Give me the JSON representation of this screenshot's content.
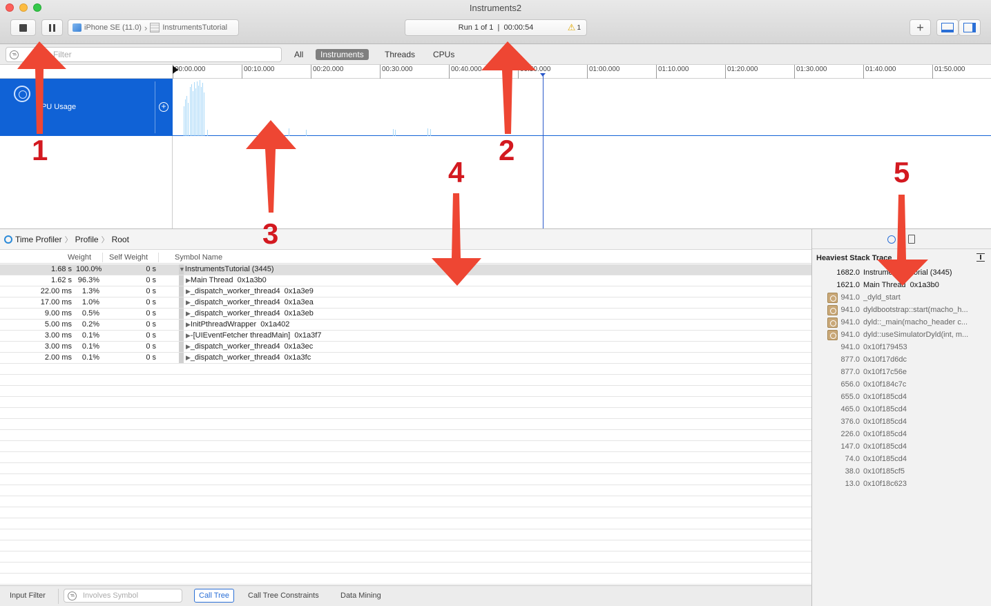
{
  "window": {
    "title": "Instruments2"
  },
  "toolbar": {
    "device": "iPhone SE (11.0)",
    "target": "InstrumentsTutorial",
    "run_status": "Run 1 of 1  |  00:00:54",
    "warning_count": "1"
  },
  "filter": {
    "placeholder": "Filter",
    "segments": [
      "All",
      "Instruments",
      "Threads",
      "CPUs"
    ],
    "active_segment": "Instruments"
  },
  "ruler": {
    "ticks": [
      "00:00.000",
      "00:10.000",
      "00:20.000",
      "00:30.000",
      "00:40.000",
      "00:50.000",
      "01:00.000",
      "01:10.000",
      "01:20.000",
      "01:30.000",
      "01:40.000",
      "01:50.000"
    ]
  },
  "track": {
    "name": "CPU Usage"
  },
  "jumpbar": {
    "items": [
      "Time Profiler",
      "Profile",
      "Root"
    ]
  },
  "table": {
    "headers": {
      "weight": "Weight",
      "self_weight": "Self Weight",
      "symbol": "Symbol Name"
    },
    "rows": [
      {
        "weight": "1.68 s",
        "percent": "100.0%",
        "self": "0 s",
        "symbol": "InstrumentsTutorial (3445)"
      },
      {
        "weight": "1.62 s",
        "percent": "96.3%",
        "self": "0 s",
        "symbol": "Main Thread  0x1a3b0"
      },
      {
        "weight": "22.00 ms",
        "percent": "1.3%",
        "self": "0 s",
        "symbol": "_dispatch_worker_thread4  0x1a3e9"
      },
      {
        "weight": "17.00 ms",
        "percent": "1.0%",
        "self": "0 s",
        "symbol": "_dispatch_worker_thread4  0x1a3ea"
      },
      {
        "weight": "9.00 ms",
        "percent": "0.5%",
        "self": "0 s",
        "symbol": "_dispatch_worker_thread4  0x1a3eb"
      },
      {
        "weight": "5.00 ms",
        "percent": "0.2%",
        "self": "0 s",
        "symbol": "InitPthreadWrapper  0x1a402"
      },
      {
        "weight": "3.00 ms",
        "percent": "0.1%",
        "self": "0 s",
        "symbol": "-[UIEventFetcher threadMain]  0x1a3f7"
      },
      {
        "weight": "3.00 ms",
        "percent": "0.1%",
        "self": "0 s",
        "symbol": "_dispatch_worker_thread4  0x1a3ec"
      },
      {
        "weight": "2.00 ms",
        "percent": "0.1%",
        "self": "0 s",
        "symbol": "_dispatch_worker_thread4  0x1a3fc"
      }
    ]
  },
  "bottombar": {
    "input_filter_label": "Input Filter",
    "involves_placeholder": "Involves Symbol",
    "buttons": [
      "Call Tree",
      "Call Tree Constraints",
      "Data Mining"
    ],
    "active_button": "Call Tree"
  },
  "inspector": {
    "title": "Heaviest Stack Trace",
    "stack": [
      {
        "value": "1682.0",
        "name": "InstrumentsTutorial (3445)"
      },
      {
        "value": "1621.0",
        "name": "Main Thread  0x1a3b0"
      },
      {
        "value": "941.0",
        "name": "_dyld_start"
      },
      {
        "value": "941.0",
        "name": "dyldbootstrap::start(macho_h..."
      },
      {
        "value": "941.0",
        "name": "dyld::_main(macho_header c..."
      },
      {
        "value": "941.0",
        "name": "dyld::useSimulatorDyld(int, m..."
      },
      {
        "value": "941.0",
        "name": "0x10f179453"
      },
      {
        "value": "877.0",
        "name": "0x10f17d6dc"
      },
      {
        "value": "877.0",
        "name": "0x10f17c56e"
      },
      {
        "value": "656.0",
        "name": "0x10f184c7c"
      },
      {
        "value": "655.0",
        "name": "0x10f185cd4"
      },
      {
        "value": "465.0",
        "name": "0x10f185cd4"
      },
      {
        "value": "376.0",
        "name": "0x10f185cd4"
      },
      {
        "value": "226.0",
        "name": "0x10f185cd4"
      },
      {
        "value": "147.0",
        "name": "0x10f185cd4"
      },
      {
        "value": "74.0",
        "name": "0x10f185cd4"
      },
      {
        "value": "38.0",
        "name": "0x10f185cf5"
      },
      {
        "value": "13.0",
        "name": "0x10f18c623"
      }
    ]
  },
  "annotations": {
    "labels": [
      "1",
      "2",
      "3",
      "4",
      "5"
    ]
  }
}
